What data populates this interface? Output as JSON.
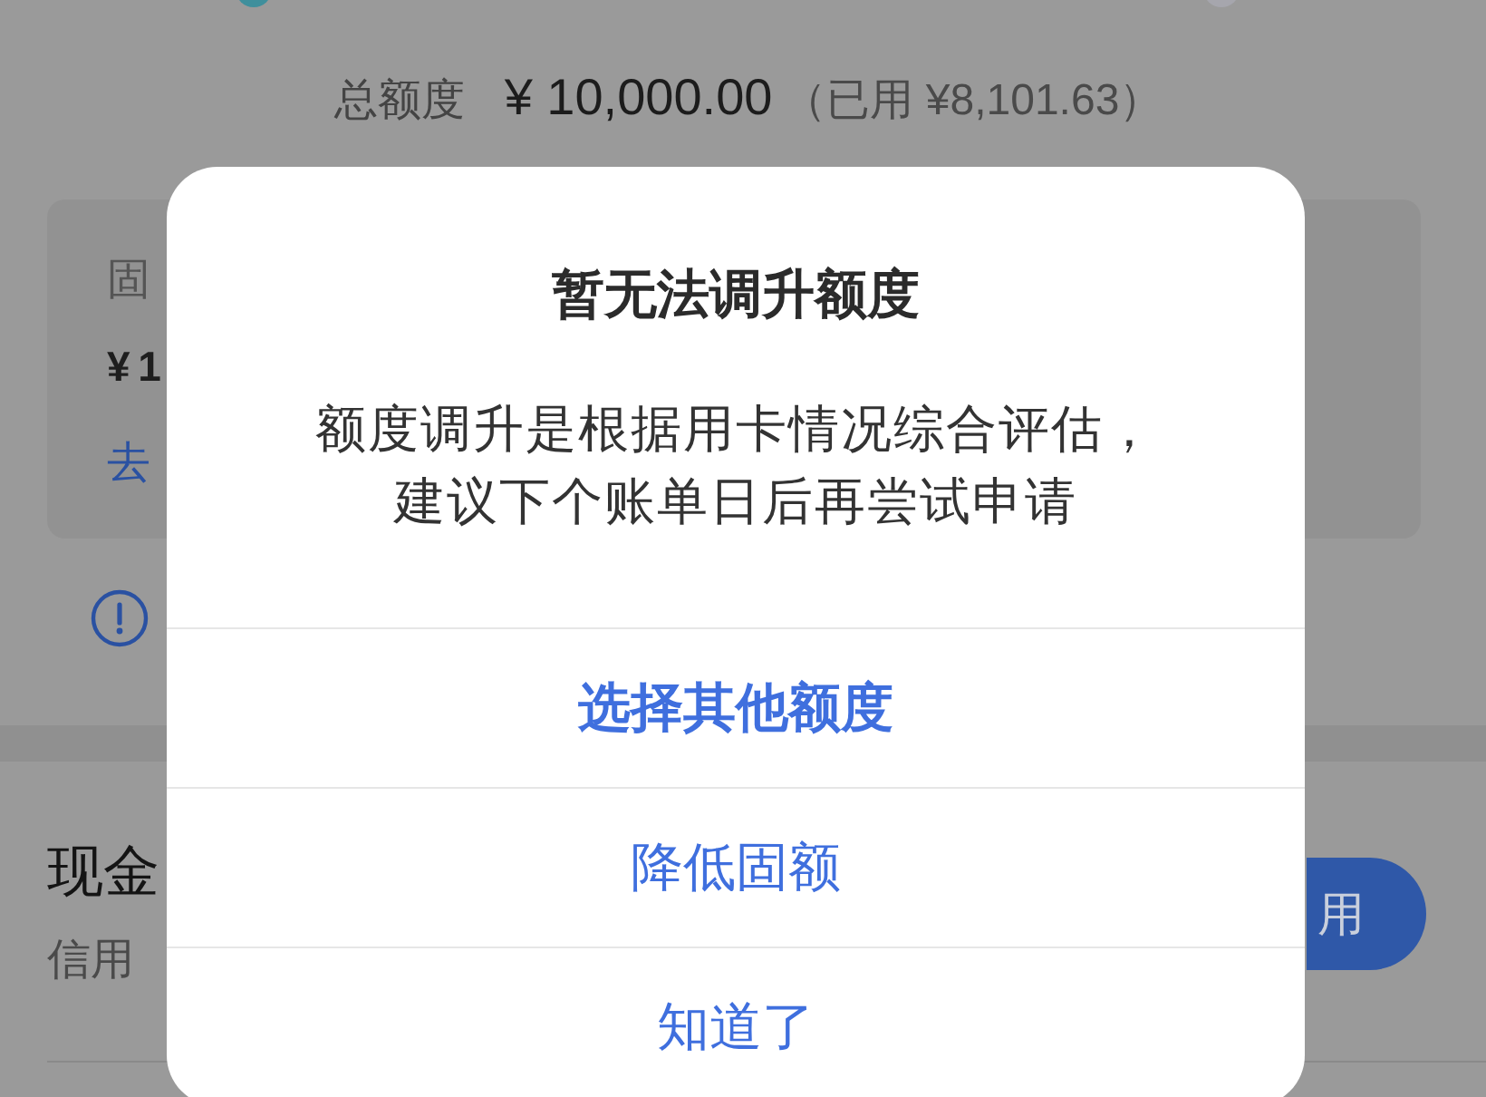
{
  "summary": {
    "label": "总额度",
    "amount": "¥ 10,000.00",
    "used": "（已用 ¥8,101.63）"
  },
  "limit_card": {
    "label": "固",
    "amount": "¥ 1",
    "link": "去"
  },
  "cash_section": {
    "title": "现金",
    "subtitle": "信用",
    "button": "用"
  },
  "dialog": {
    "title": "暂无法调升额度",
    "message": "额度调升是根据用卡情况综合评估，建议下个账单日后再尝试申请",
    "actions": [
      {
        "label": "选择其他额度",
        "kind": "emphasis"
      },
      {
        "label": "降低固额",
        "kind": "plain"
      },
      {
        "label": "知道了",
        "kind": "plain"
      }
    ]
  }
}
